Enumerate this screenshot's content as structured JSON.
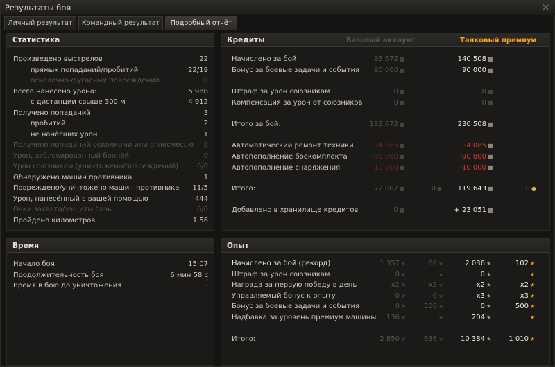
{
  "window": {
    "title": "Результаты боя"
  },
  "tabs": [
    {
      "label": "Личный результат",
      "active": false
    },
    {
      "label": "Командный результат",
      "active": false
    },
    {
      "label": "Подробный отчёт",
      "active": true
    }
  ],
  "stats": {
    "title": "Статистика",
    "rows": [
      {
        "label": "Произведено выстрелов",
        "value": "22",
        "indent": false,
        "dim": false
      },
      {
        "label": "прямых попаданий/пробитий",
        "value": "22/19",
        "indent": true,
        "dim": false
      },
      {
        "label": "осколочно-фугасных повреждений",
        "value": "0",
        "indent": true,
        "dim": true
      },
      {
        "label": "Всего нанесено урона:",
        "value": "5 988",
        "indent": false,
        "dim": false
      },
      {
        "label": "с дистанции свыше 300 м",
        "value": "4 912",
        "indent": true,
        "dim": false
      },
      {
        "label": "Получено попаданий",
        "value": "3",
        "indent": false,
        "dim": false
      },
      {
        "label": "пробитий",
        "value": "2",
        "indent": true,
        "dim": false
      },
      {
        "label": "не нанёсших урон",
        "value": "1",
        "indent": true,
        "dim": false
      },
      {
        "label": "Получено попаданий осколками или огнесмесью",
        "value": "0",
        "indent": false,
        "dim": true
      },
      {
        "label": "Урон, заблокированный бронёй",
        "value": "0",
        "indent": false,
        "dim": true
      },
      {
        "label": "Урон союзникам (уничтожено/повреждений)",
        "value": "0/0",
        "indent": false,
        "dim": true
      },
      {
        "label": "Обнаружено машин противника",
        "value": "1",
        "indent": false,
        "dim": false
      },
      {
        "label": "Повреждено/уничтожено машин противника",
        "value": "11/5",
        "indent": false,
        "dim": false
      },
      {
        "label": "Урон, нанесённый с вашей помощью",
        "value": "444",
        "indent": false,
        "dim": false
      },
      {
        "label": "Очки захвата/защиты базы",
        "value": "0/0",
        "indent": false,
        "dim": true
      },
      {
        "label": "Пройдено километров",
        "value": "1,56",
        "indent": false,
        "dim": false
      }
    ]
  },
  "time": {
    "title": "Время",
    "rows": [
      {
        "label": "Начало боя",
        "value": "15:07",
        "dim": false
      },
      {
        "label": "Продолжительность боя",
        "value": "6 мин 58 с",
        "dim": false
      },
      {
        "label": "Время в бою до уничтожения",
        "value": "-",
        "dim": true
      }
    ]
  },
  "credits": {
    "title": "Кредиты",
    "col_base": "Базовый аккаунт",
    "col_premium": "Танковый премиум",
    "rows": [
      {
        "label": "Начислено за бой",
        "base": "93 672",
        "base_style": "dim",
        "premium": "140 508",
        "premium_style": "bright",
        "gap": 0
      },
      {
        "label": "Бонус за боевые задачи и события",
        "base": "90 000",
        "base_style": "dim",
        "premium": "90 000",
        "premium_style": "bright",
        "gap": 0
      },
      {
        "label": "Штраф за урон союзникам",
        "base": "0",
        "base_style": "dim",
        "premium": "0",
        "premium_style": "dim",
        "gap": 1
      },
      {
        "label": "Компенсация за урон от союзников",
        "base": "0",
        "base_style": "dim",
        "premium": "0",
        "premium_style": "dim",
        "gap": 1
      },
      {
        "label": "Итого за бой:",
        "base": "183 672",
        "base_style": "dim",
        "premium": "230 508",
        "premium_style": "bright",
        "gap": 2
      },
      {
        "label": "Автоматический ремонт техники",
        "base": "-4 085",
        "base_style": "dimred",
        "premium": "-4 085",
        "premium_style": "red",
        "gap": 3
      },
      {
        "label": "Автопополнение боекомплекта",
        "base": "-90 800",
        "base_style": "dimred",
        "premium": "-90 800",
        "premium_style": "red",
        "gap": 3
      },
      {
        "label": "Автопополнение снаряжения",
        "base": "-10 000",
        "base_style": "dimred",
        "premium": "-10 000",
        "premium_style": "red",
        "gap": 3
      },
      {
        "label": "Итого:",
        "base": "72 807",
        "base_style": "dim",
        "base_gold": "0",
        "premium": "119 643",
        "premium_style": "bright",
        "premium_gold": "0",
        "gap": 4
      },
      {
        "label": "Добавлено в хранилище кредитов",
        "base": "0",
        "base_style": "dim",
        "premium": "+ 23 051",
        "premium_style": "bright",
        "gap": 5
      }
    ]
  },
  "xp": {
    "title": "Опыт",
    "rows": [
      {
        "label": "Начислено за бой (рекорд)",
        "b1": "1 357",
        "b2": "68",
        "p1": "2 036",
        "p2": "102",
        "bright_label": true
      },
      {
        "label": "Штраф за урон союзникам",
        "b1": "0",
        "b2": "",
        "p1": "0",
        "p2": "",
        "bright_label": false
      },
      {
        "label": "Награда за первую победу в день",
        "b1": "x2",
        "b2": "x2",
        "p1": "x2",
        "p2": "x2",
        "bright_label": false
      },
      {
        "label": "Управляемый бонус к опыту",
        "b1": "0",
        "b2": "0",
        "p1": "x3",
        "p2": "x3",
        "bright_label": false
      },
      {
        "label": "Бонус за боевые задачи и события",
        "b1": "0",
        "b2": "500",
        "p1": "0",
        "p2": "500",
        "bright_label": false
      },
      {
        "label": "Надбавка за уровень премиум машины",
        "b1": "136",
        "b2": "",
        "p1": "204",
        "p2": "",
        "bright_label": false
      }
    ],
    "total": {
      "label": "Итого:",
      "b1": "2 850",
      "b2": "636",
      "p1": "10 384",
      "p2": "1 010"
    }
  },
  "colors": {
    "premium_header": "#f0a020",
    "negative": "#d23b27",
    "gold_icon": "#d8b250"
  }
}
